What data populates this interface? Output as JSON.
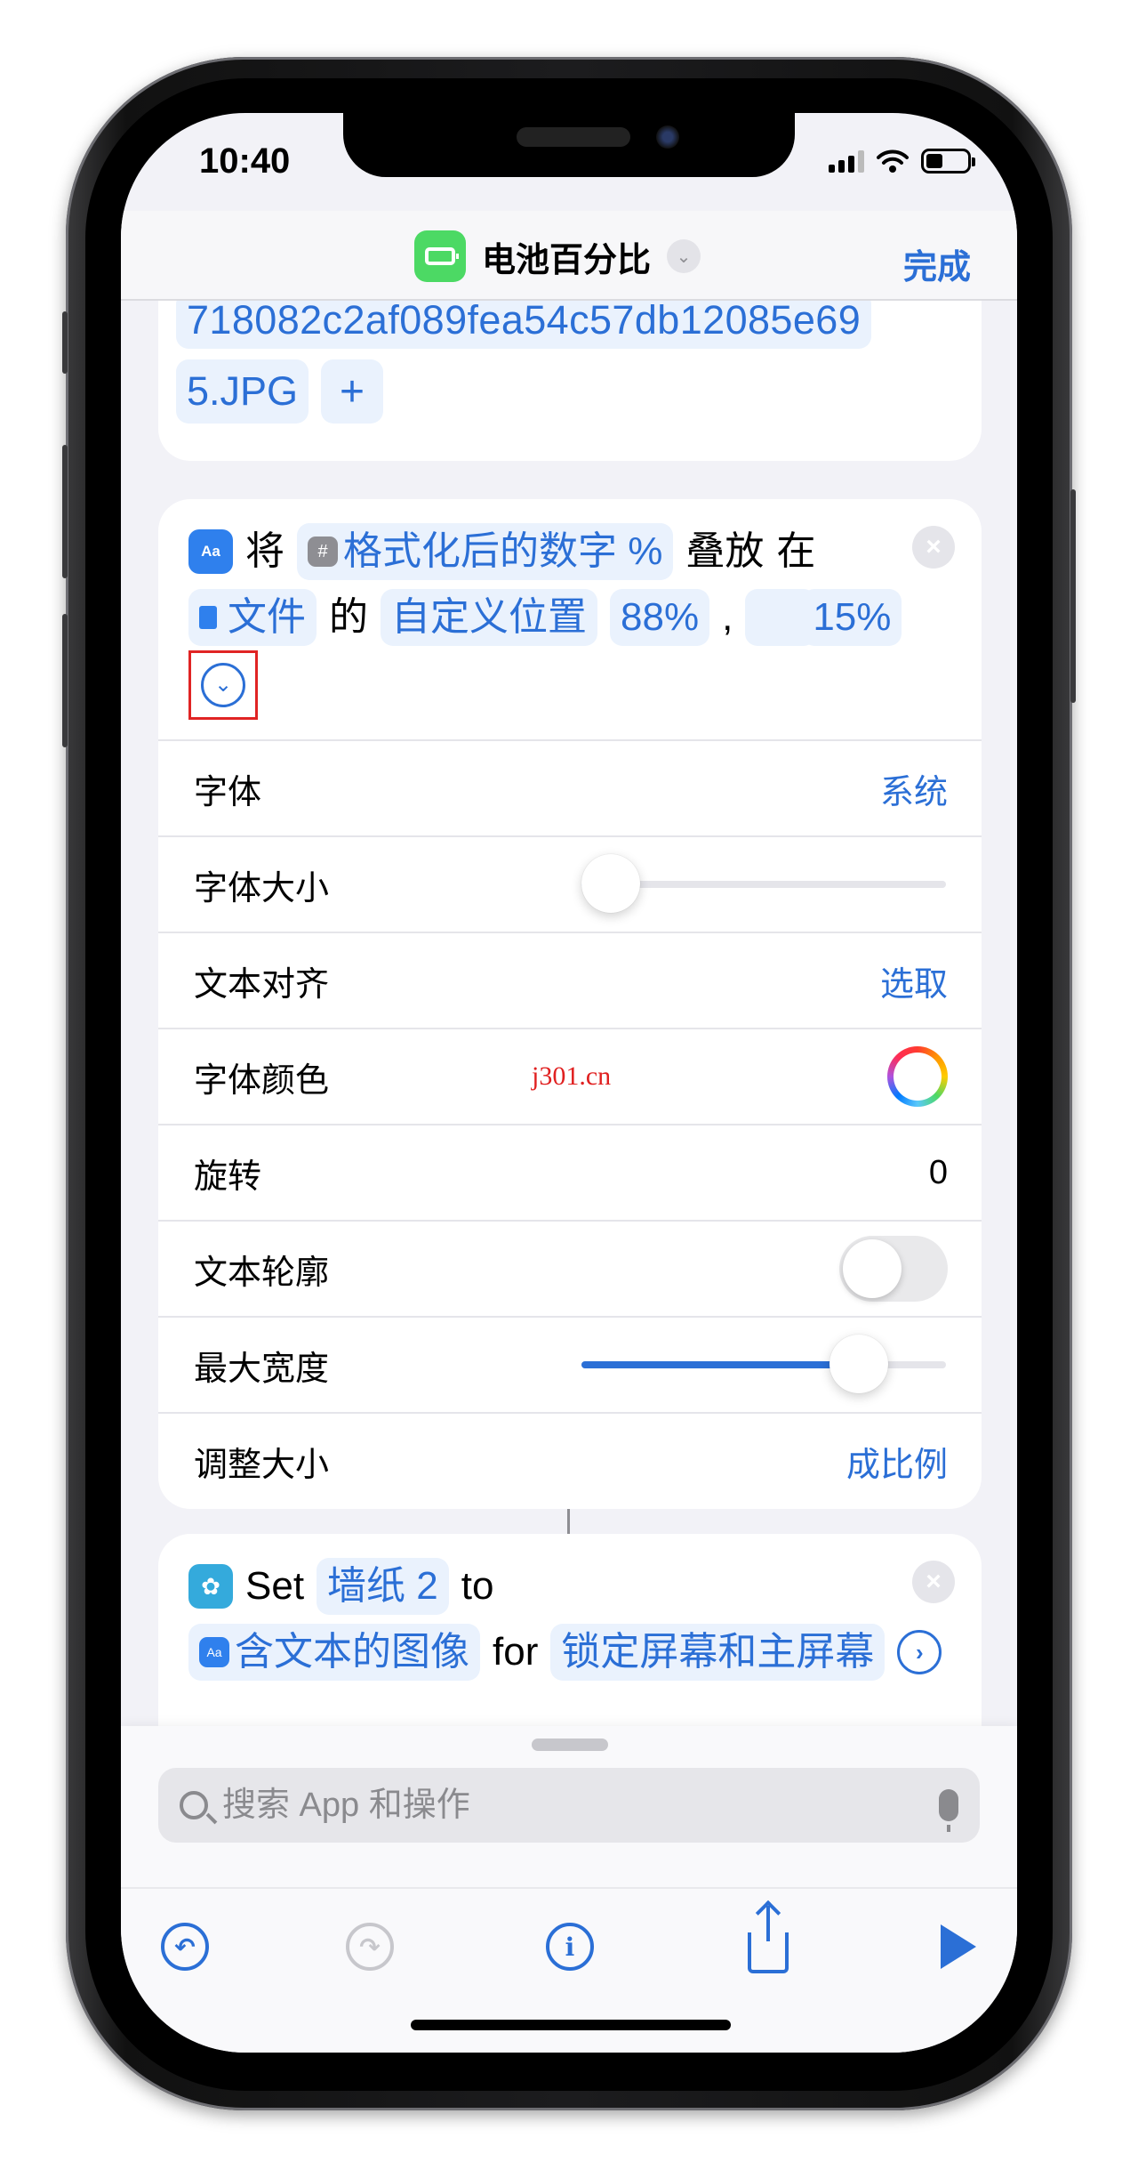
{
  "status_bar": {
    "time": "10:40",
    "signal_icon": "cellular-signal-icon",
    "wifi_icon": "wifi-icon",
    "battery_icon": "battery-icon"
  },
  "nav": {
    "title": "电池百分比",
    "shortcut_icon": "battery-shortcut-icon",
    "title_menu_icon": "chevron-down-icon",
    "done_label": "完成"
  },
  "card_file": {
    "filename_line1": "718082c2af089fea54c57db12085e69",
    "filename_line2": "5.JPG",
    "add_label": "+"
  },
  "card_overlay": {
    "app_icon_label": "Aa",
    "word_1": "将",
    "variable_icon_label": "#",
    "variable": "格式化后的数字 %",
    "word_2": "叠放",
    "word_3": "在",
    "file_token": "文件",
    "word_4": "的",
    "position_token": "自定义位置",
    "x_value": "88%",
    "comma": ",",
    "y_value": "15%",
    "close_label": "×",
    "expand_label": "⌄",
    "params": [
      {
        "label": "字体",
        "value": "系统"
      },
      {
        "label": "字体大小",
        "slider_fraction": 0.04
      },
      {
        "label": "文本对齐",
        "value": "选取"
      },
      {
        "label": "字体颜色",
        "value_type": "color-picker"
      },
      {
        "label": "旋转",
        "value": "0"
      },
      {
        "label": "文本轮廓",
        "toggle_on": false
      },
      {
        "label": "最大宽度",
        "slider_fraction": 0.76
      },
      {
        "label": "调整大小",
        "value": "成比例"
      }
    ],
    "watermark": "j301.cn"
  },
  "card_wallpaper": {
    "word_set": "Set",
    "wallpaper_token": "墙纸 2",
    "word_to": "to",
    "image_token": "含文本的图像",
    "word_for": "for",
    "target_token": "锁定屏幕和主屏幕",
    "close_label": "×",
    "more_label": "›"
  },
  "search": {
    "placeholder": "搜索 App 和操作",
    "value": ""
  },
  "toolbar": {
    "undo_label": "↶",
    "redo_label": "↷",
    "info_label": "i"
  },
  "colors": {
    "accent": "#2b6fd6",
    "shortcut_green": "#4cd964",
    "highlight_red": "#e02424"
  }
}
